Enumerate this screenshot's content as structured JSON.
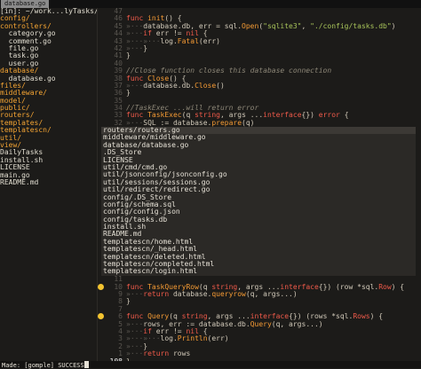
{
  "tab": {
    "label": "database.go"
  },
  "tree": {
    "header": "[in]: ~/work...lyTasks/",
    "items": [
      {
        "label": "config/",
        "type": "dir"
      },
      {
        "label": "controllers/",
        "type": "dir"
      },
      {
        "label": "  category.go",
        "type": "file"
      },
      {
        "label": "  comment.go",
        "type": "file"
      },
      {
        "label": "  file.go",
        "type": "file"
      },
      {
        "label": "  task.go",
        "type": "file"
      },
      {
        "label": "  user.go",
        "type": "file"
      },
      {
        "label": "database/",
        "type": "dir"
      },
      {
        "label": "  database.go",
        "type": "file"
      },
      {
        "label": "files/",
        "type": "dir"
      },
      {
        "label": "middleware/",
        "type": "dir"
      },
      {
        "label": "model/",
        "type": "dir"
      },
      {
        "label": "public/",
        "type": "dir"
      },
      {
        "label": "routers/",
        "type": "dir"
      },
      {
        "label": "templates/",
        "type": "dir"
      },
      {
        "label": "templatescn/",
        "type": "dir"
      },
      {
        "label": "util/",
        "type": "dir"
      },
      {
        "label": "view/",
        "type": "dir"
      },
      {
        "label": "DailyTasks",
        "type": "file"
      },
      {
        "label": "install.sh",
        "type": "file"
      },
      {
        "label": "LICENSE",
        "type": "file"
      },
      {
        "label": "main.go",
        "type": "file"
      },
      {
        "label": "README.md",
        "type": "file"
      }
    ]
  },
  "editor": {
    "top_lines": [
      {
        "ln": "47",
        "html": ""
      },
      {
        "ln": "46",
        "html": "<span class='kw'>func</span> <span class='fn'>init</span>() {"
      },
      {
        "ln": "45",
        "html": "<span class='dim'>»···</span>database.db, err = sql.<span class='fn'>Open</span>(<span class='st'>\"sqlite3\"</span>, <span class='st'>\"./config/tasks.db\"</span>)"
      },
      {
        "ln": "44",
        "html": "<span class='dim'>»···</span><span class='kw'>if</span> err != <span class='kw'>nil</span> {"
      },
      {
        "ln": "43",
        "html": "<span class='dim'>»···»···</span>log.<span class='fn'>Fatal</span>(err)"
      },
      {
        "ln": "42",
        "html": "<span class='dim'>»···</span>}"
      },
      {
        "ln": "41",
        "html": "}"
      },
      {
        "ln": "40",
        "html": ""
      },
      {
        "ln": "39",
        "html": "<span class='cm'>//Close function closes this database connection</span>"
      },
      {
        "ln": "38",
        "html": "<span class='kw'>func</span> <span class='fn'>Close</span>() {"
      },
      {
        "ln": "37",
        "html": "<span class='dim'>»···</span>database.db.<span class='fn'>Close</span>()"
      },
      {
        "ln": "36",
        "html": "}"
      },
      {
        "ln": "35",
        "html": ""
      },
      {
        "ln": "34",
        "html": "<span class='cm'>//TaskExec ...will return error</span>"
      },
      {
        "ln": "33",
        "html": "<span class='kw'>func</span> <span class='fn'>TaskExec</span>(q <span class='kw'>string</span>, args ...<span class='kw'>interface</span>{}) <span class='kw'>error</span> {"
      },
      {
        "ln": "32",
        "html": "<span class='dim'>»···</span>SQL := database.<span class='fn'>prepare</span>(q)"
      }
    ],
    "bottom_lines": [
      {
        "ln": "11",
        "icon": false,
        "html": ""
      },
      {
        "ln": "10",
        "icon": true,
        "html": "<span class='kw'>func</span> <span class='fn'>TaskQueryRow</span>(q <span class='kw'>string</span>, args ...<span class='kw'>interface</span>{}) (row *sql.<span class='kw'>Row</span>) {"
      },
      {
        "ln": "9",
        "icon": false,
        "html": "<span class='dim'>»···</span><span class='kw'>return</span> database.<span class='fn'>queryrow</span>(q, args...)"
      },
      {
        "ln": "8",
        "icon": false,
        "html": "}"
      },
      {
        "ln": "7",
        "icon": false,
        "html": ""
      },
      {
        "ln": "6",
        "icon": true,
        "html": "<span class='kw'>func</span> <span class='fn'>Query</span>(q <span class='kw'>string</span>, args ...<span class='kw'>interface</span>{}) (rows *sql.<span class='kw'>Rows</span>) {"
      },
      {
        "ln": "5",
        "icon": false,
        "html": "<span class='dim'>»···</span>rows, err := database.db.<span class='fn'>Query</span>(q, args...)"
      },
      {
        "ln": "4",
        "icon": false,
        "html": "<span class='dim'>»···</span><span class='kw'>if</span> err != <span class='kw'>nil</span> {"
      },
      {
        "ln": "3",
        "icon": false,
        "html": "<span class='dim'>»···»···</span>log.<span class='fn'>Println</span>(err)"
      },
      {
        "ln": "2",
        "icon": false,
        "html": "<span class='dim'>»···</span>}"
      },
      {
        "ln": "1",
        "icon": false,
        "html": "<span class='dim'>»···</span><span class='kw'>return</span> rows"
      },
      {
        "ln": "108",
        "icon": false,
        "cur": true,
        "html": "}"
      }
    ]
  },
  "completion": {
    "items": [
      "routers/routers.go",
      "middleware/middleware.go",
      "database/database.go",
      ".DS_Store",
      "LICENSE",
      "util/cmd/cmd.go",
      "util/jsonconfig/jsonconfig.go",
      "util/sessions/sessions.go",
      "util/redirect/redirect.go",
      "config/.DS_Store",
      "config/schema.sql",
      "config/config.json",
      "config/tasks.db",
      "install.sh",
      "README.md",
      "templatescn/home.html",
      "templatescn/_head.html",
      "templatescn/deleted.html",
      "templatescn/completed.html",
      "templatescn/login.html"
    ]
  },
  "status": {
    "text": "Made: [gomple] SUCCESS"
  },
  "colors": {
    "bg": "#1c1b19",
    "dir": "#f4a433",
    "keyword": "#f05a4a",
    "func": "#f49a34",
    "string": "#a8c45a",
    "comment": "#8c8677"
  }
}
